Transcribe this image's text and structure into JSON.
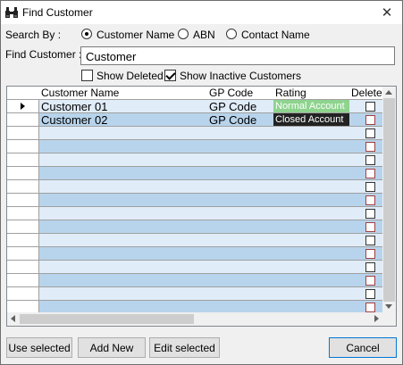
{
  "window": {
    "title": "Find Customer"
  },
  "search_by": {
    "label": "Search By :",
    "options": [
      {
        "label": "Customer Name",
        "selected": true
      },
      {
        "label": "ABN",
        "selected": false
      },
      {
        "label": "Contact Name",
        "selected": false
      }
    ]
  },
  "find": {
    "label": "Find Customer :",
    "value": "Customer"
  },
  "filters": {
    "show_deleted": {
      "label": "Show Deleted",
      "checked": false
    },
    "show_inactive": {
      "label": "Show Inactive Customers",
      "checked": true
    }
  },
  "grid": {
    "columns": [
      "Customer Name",
      "GP Code",
      "Rating",
      "Deleted"
    ],
    "rows": [
      {
        "customer_name": "Customer 01",
        "gp_code": "GP Code",
        "rating": "Normal Account",
        "rating_color": "#8ed38e",
        "deleted": false
      },
      {
        "customer_name": "Customer 02",
        "gp_code": "GP Code",
        "rating": "Closed Account",
        "rating_color": "#222222",
        "deleted": false
      }
    ],
    "empty_rows": 14
  },
  "buttons": {
    "use_selected": "Use selected",
    "add_new": "Add New",
    "edit_selected": "Edit selected",
    "cancel": "Cancel"
  },
  "colors": {
    "row_stripe_a": "#e0ecf8",
    "row_stripe_b": "#b8d4ec"
  }
}
